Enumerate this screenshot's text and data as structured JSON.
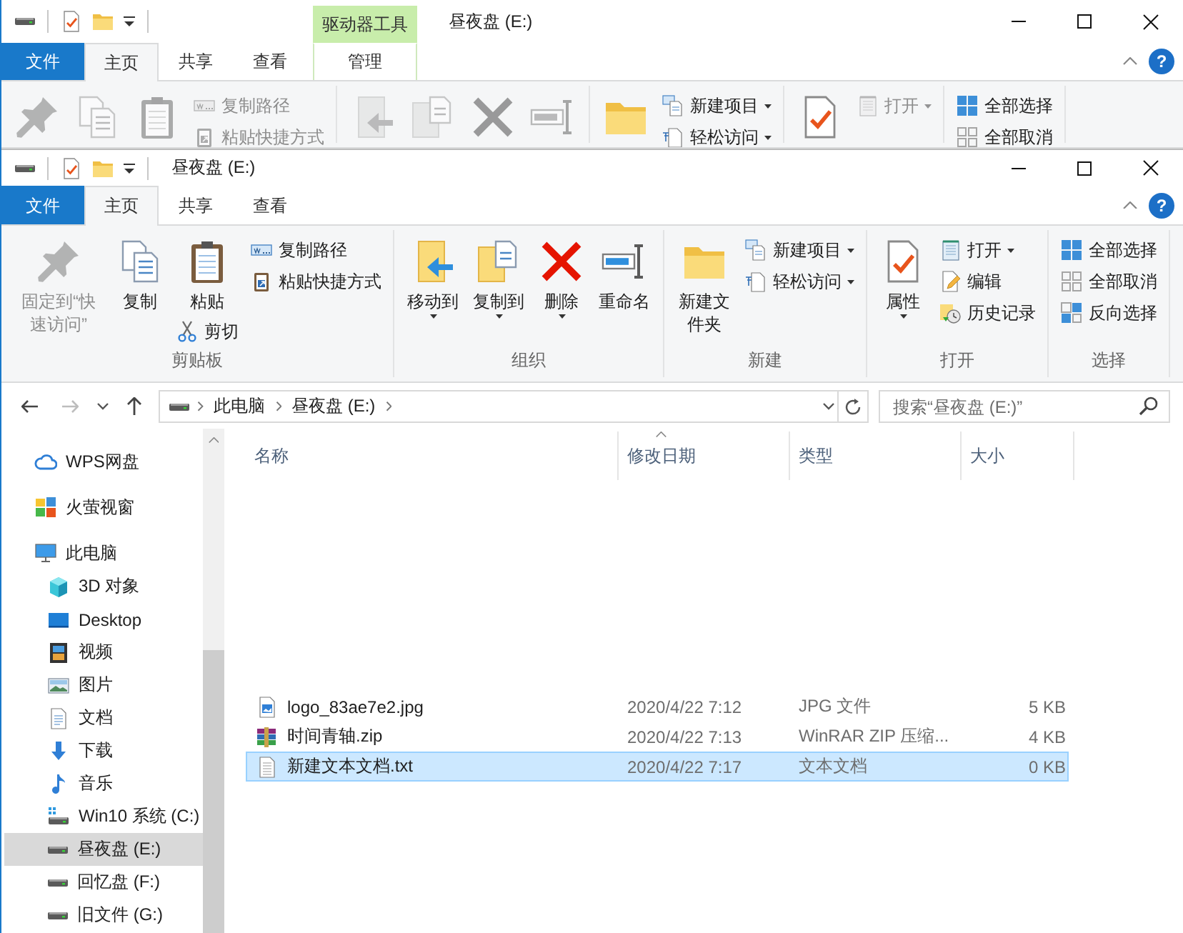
{
  "back_window": {
    "title": "昼夜盘 (E:)",
    "contextual_tab": {
      "group": "驱动器工具",
      "label": "管理",
      "selected": false
    },
    "tabs": [
      {
        "label": "文件",
        "kind": "file",
        "selected": false
      },
      {
        "label": "主页",
        "kind": "tab",
        "selected": true
      },
      {
        "label": "共享",
        "kind": "tab",
        "selected": false
      },
      {
        "label": "查看",
        "kind": "tab",
        "selected": false
      }
    ],
    "help": "?",
    "ribbon": {
      "groups": [
        {
          "items": [
            {
              "kind": "pin",
              "disabled": true,
              "dropdown": false
            },
            {
              "kind": "copy",
              "disabled": true,
              "dropdown": false
            },
            {
              "kind": "paste",
              "disabled": true,
              "dropdown": false
            },
            {
              "stack": [
                {
                  "kind": "copy-path",
                  "label": "复制路径",
                  "disabled": true,
                  "dropdown": false
                },
                {
                  "kind": "shortcut",
                  "label": "粘贴快捷方式",
                  "disabled": true,
                  "dropdown": false
                }
              ]
            }
          ]
        },
        {
          "items": [
            {
              "kind": "move",
              "disabled": true,
              "dropdown": false
            },
            {
              "kind": "copy-to",
              "disabled": true,
              "dropdown": false
            },
            {
              "kind": "delete",
              "disabled": true,
              "dropdown": false
            },
            {
              "kind": "rename",
              "disabled": true,
              "dropdown": false
            }
          ]
        },
        {
          "items": [
            {
              "kind": "folder",
              "disabled": false,
              "dropdown": false
            },
            {
              "stack": [
                {
                  "kind": "new-item",
                  "label": "新建项目",
                  "disabled": false,
                  "dropdown": true
                },
                {
                  "kind": "easy-access",
                  "label": "轻松访问",
                  "disabled": false,
                  "dropdown": true
                }
              ]
            }
          ]
        },
        {
          "items": [
            {
              "kind": "properties",
              "disabled": false,
              "dropdown": false
            },
            {
              "stack": [
                {
                  "kind": "open",
                  "label": "打开",
                  "disabled": true,
                  "dropdown": true
                }
              ]
            }
          ]
        },
        {
          "items": [
            {
              "stack": [
                {
                  "kind": "select-all",
                  "label": "全部选择",
                  "disabled": false,
                  "dropdown": false
                },
                {
                  "kind": "select-none",
                  "label": "全部取消",
                  "disabled": false,
                  "dropdown": false
                }
              ]
            }
          ]
        }
      ]
    }
  },
  "window": {
    "title": "昼夜盘 (E:)",
    "tabs": [
      {
        "label": "文件",
        "kind": "file",
        "selected": false
      },
      {
        "label": "主页",
        "kind": "tab",
        "selected": true
      },
      {
        "label": "共享",
        "kind": "tab",
        "selected": false
      },
      {
        "label": "查看",
        "kind": "tab",
        "selected": false
      }
    ],
    "help": "?",
    "ribbon": {
      "groups": [
        {
          "label": "剪贴板",
          "items": [
            {
              "kind": "pin",
              "label": "固定到“快速访问”",
              "disabled": true,
              "dropdown": false
            },
            {
              "kind": "copy",
              "label": "复制",
              "disabled": false,
              "dropdown": false
            },
            {
              "kind": "paste",
              "label": "粘贴",
              "disabled": false,
              "dropdown": false,
              "below": {
                "kind": "cut",
                "label": "剪切",
                "disabled": false,
                "dropdown": false
              }
            },
            {
              "stack": [
                {
                  "kind": "copy-path",
                  "label": "复制路径",
                  "disabled": false,
                  "dropdown": false
                },
                {
                  "kind": "shortcut",
                  "label": "粘贴快捷方式",
                  "disabled": false,
                  "dropdown": false
                }
              ]
            }
          ]
        },
        {
          "label": "组织",
          "items": [
            {
              "kind": "move",
              "label": "移动到",
              "disabled": false,
              "dropdown": true
            },
            {
              "kind": "copy-to",
              "label": "复制到",
              "disabled": false,
              "dropdown": true
            },
            {
              "kind": "delete",
              "label": "删除",
              "disabled": false,
              "dropdown": true
            },
            {
              "kind": "rename",
              "label": "重命名",
              "disabled": false,
              "dropdown": false
            }
          ]
        },
        {
          "label": "新建",
          "items": [
            {
              "kind": "folder",
              "label": "新建文件夹",
              "disabled": false,
              "dropdown": false
            },
            {
              "stack": [
                {
                  "kind": "new-item",
                  "label": "新建项目",
                  "disabled": false,
                  "dropdown": true
                },
                {
                  "kind": "easy-access",
                  "label": "轻松访问",
                  "disabled": false,
                  "dropdown": true
                }
              ]
            }
          ]
        },
        {
          "label": "打开",
          "items": [
            {
              "kind": "properties",
              "label": "属性",
              "disabled": false,
              "dropdown": true
            },
            {
              "stack": [
                {
                  "kind": "open",
                  "label": "打开",
                  "disabled": false,
                  "dropdown": true
                },
                {
                  "kind": "edit",
                  "label": "编辑",
                  "disabled": false,
                  "dropdown": false
                },
                {
                  "kind": "history",
                  "label": "历史记录",
                  "disabled": false,
                  "dropdown": false
                }
              ]
            }
          ]
        },
        {
          "label": "选择",
          "items": [
            {
              "stack": [
                {
                  "kind": "select-all",
                  "label": "全部选择",
                  "disabled": false,
                  "dropdown": false
                },
                {
                  "kind": "select-none",
                  "label": "全部取消",
                  "disabled": false,
                  "dropdown": false
                },
                {
                  "kind": "invert",
                  "label": "反向选择",
                  "disabled": false,
                  "dropdown": false
                }
              ]
            }
          ]
        }
      ]
    },
    "nav_buttons": [
      {
        "kind": "back",
        "disabled": false
      },
      {
        "kind": "forward",
        "disabled": true
      },
      {
        "kind": "recent",
        "disabled": false
      },
      {
        "kind": "up",
        "disabled": false
      }
    ],
    "address": {
      "crumbs": [
        "此电脑",
        "昼夜盘 (E:)"
      ]
    },
    "search": {
      "placeholder": "搜索“昼夜盘 (E:)”"
    },
    "sidebar": {
      "items": [
        {
          "label": "WPS网盘",
          "kind": "cloud",
          "selected": false
        },
        {
          "label": "火萤视窗",
          "kind": "app",
          "selected": false
        },
        {
          "label": "此电脑",
          "kind": "pc",
          "selected": false,
          "children": [
            {
              "label": "3D 对象",
              "kind": "objects",
              "selected": false
            },
            {
              "label": "Desktop",
              "kind": "desktop",
              "selected": false
            },
            {
              "label": "视频",
              "kind": "videos",
              "selected": false
            },
            {
              "label": "图片",
              "kind": "pictures",
              "selected": false
            },
            {
              "label": "文档",
              "kind": "documents",
              "selected": false
            },
            {
              "label": "下载",
              "kind": "downloads",
              "selected": false
            },
            {
              "label": "音乐",
              "kind": "music",
              "selected": false
            },
            {
              "label": "Win10 系统 (C:)",
              "kind": "system-drive",
              "selected": false
            },
            {
              "label": "昼夜盘 (E:)",
              "kind": "drive",
              "selected": true
            },
            {
              "label": "回忆盘 (F:)",
              "kind": "drive",
              "selected": false
            },
            {
              "label": "旧文件 (G:)",
              "kind": "drive",
              "selected": false
            }
          ]
        }
      ]
    },
    "file_list": {
      "columns": [
        {
          "label": "名称",
          "sorted": false
        },
        {
          "label": "修改日期",
          "sorted": true
        },
        {
          "label": "类型",
          "sorted": false
        },
        {
          "label": "大小",
          "sorted": false
        }
      ],
      "rows": [
        {
          "kind": "image",
          "name": "logo_83ae7e2.jpg",
          "modified": "2020/4/22 7:12",
          "type": "JPG 文件",
          "size": "5 KB",
          "selected": false
        },
        {
          "kind": "archive",
          "name": "时间青轴.zip",
          "modified": "2020/4/22 7:13",
          "type": "WinRAR ZIP 压缩...",
          "size": "4 KB",
          "selected": false
        },
        {
          "kind": "text",
          "name": "新建文本文档.txt",
          "modified": "2020/4/22 7:17",
          "type": "文本文档",
          "size": "0 KB",
          "selected": true
        }
      ]
    }
  }
}
